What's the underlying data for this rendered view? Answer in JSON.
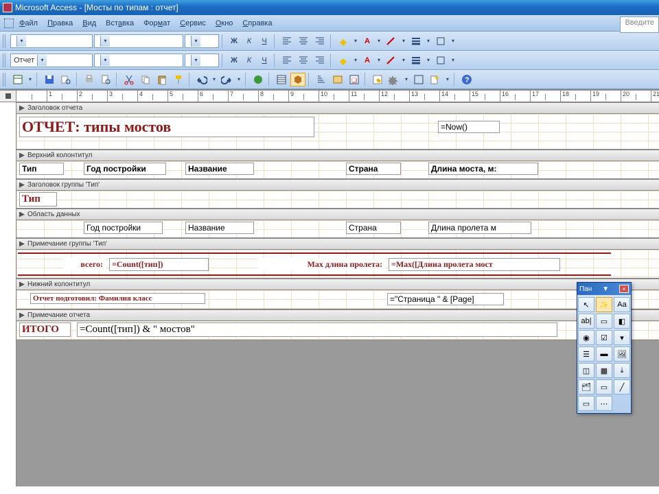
{
  "window": {
    "title": "Microsoft Access - [Мосты по типам : отчет]"
  },
  "menu": {
    "file": "Файл",
    "edit": "Правка",
    "view": "Вид",
    "insert": "Вставка",
    "format": "Формат",
    "service": "Сервис",
    "window": "Окно",
    "help": "Справка",
    "typehere": "Введите"
  },
  "toolbar2": {
    "object_combo": "Отчет"
  },
  "design": {
    "sections": {
      "report_header": "Заголовок отчета",
      "page_header": "Верхний колонтитул",
      "group_header": "Заголовок группы 'Тип'",
      "detail": "Область данных",
      "group_footer": "Примечание группы 'Тип'",
      "page_footer": "Нижний колонтитул",
      "report_footer": "Примечание отчета"
    },
    "controls": {
      "title": "ОТЧЕТ: типы мостов",
      "now": "=Now()",
      "h_type": "Тип",
      "h_year": "Год постройки",
      "h_name": "Название",
      "h_country": "Страна",
      "h_len": "Длина моста, м:",
      "g_type": "Тип",
      "d_year": "Год постройки",
      "d_name": "Название",
      "d_country": "Страна",
      "d_len": "Длина пролета м",
      "f_total_lbl": "всего:",
      "f_total": "=Count([тип])",
      "f_max_lbl": "Мах длина пролета:",
      "f_max": "=Мах([Длина пролета мост",
      "pf_author": "Отчет подготовил: Фамилия класс",
      "pf_page": "=\"Страница \" & [Page]",
      "rf_lbl": "ИТОГО",
      "rf_val": "=Count([тип]) & \" мостов\""
    }
  },
  "toolbox": {
    "title": "Пан",
    "items": [
      "pointer",
      "wizard",
      "label",
      "textbox",
      "option-group",
      "toggle",
      "option",
      "checkbox",
      "combo",
      "list",
      "button",
      "image",
      "unbound",
      "bound",
      "pagebreak",
      "tab",
      "subform",
      "line",
      "rect",
      "more"
    ]
  },
  "ruler": {
    "max": 21
  }
}
